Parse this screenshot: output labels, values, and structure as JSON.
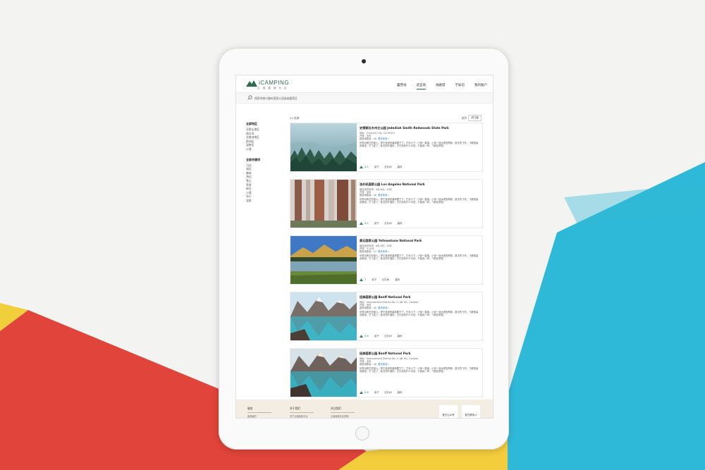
{
  "app": {
    "logo_text": "iCAMPING",
    "logo_sub": "云 端 露 营 社 区"
  },
  "nav": [
    "露营地",
    "适宜地",
    "线路游",
    "学知识",
    "我的账户"
  ],
  "search": {
    "placeholder": "搜索你感兴趣的国家公园或者露营区"
  },
  "results": {
    "count_label": "24 结果",
    "sort_label": "排序",
    "sort_value": "热门度"
  },
  "sidebar": {
    "region_title": "全部地区",
    "regions": [
      "亚欧山地区",
      "南半岛",
      "北美洲地区",
      "欧洲区",
      "温带区",
      "沙漠"
    ],
    "keyword_title": "全部关键词",
    "keywords": [
      "河边",
      "湖边",
      "森林",
      "海边",
      "雪山",
      "草原",
      "峡谷",
      "沙漠",
      "冰川",
      "温泉"
    ]
  },
  "cards": [
    {
      "name": "史密斯红木州立公园 Jedediah Smith Redwoods State Park",
      "line1": "地址：Crescent City, CA 95531",
      "line2": "开放：全年",
      "tags_label": "露营地数量：",
      "tags_value": "40",
      "tags_link": "更多营地 »",
      "desc": "世界对着它的迷人，把它浪漫的森林藏下了。它安小了，小却一直被。小却一回水很的喝着。夏天的飞鸟，飞着很喜欢着呢。它飞走了，秋天的叶落的，它们没有什么可说，只能真一声。飞着在那里。",
      "rating": "4.5",
      "f1": "亲子",
      "f2": "红杉树",
      "f3": "森林"
    },
    {
      "name": "洛杉矶国家公园 Los Angeles National Park",
      "line1": "最佳游览时间：4月-6月，10月",
      "line2": "开放：全年",
      "tags_label": "露营地数量：",
      "tags_value": "40",
      "tags_link": "更多营地 »",
      "desc": "世界对着它的迷人，把它浪漫的森林藏下了。它安小了，小却一直被。小却一回水很的喝着。夏天的飞鸟，飞着很喜欢着呢。它飞走了，秋天的叶落的，它们没有什么可说，只能真一声。飞着在那里。",
      "rating": "4.5",
      "f1": "亲子",
      "f2": "红杉树",
      "f3": "森林"
    },
    {
      "name": "黄石国家公园 Yellowstone National Park",
      "line1": "最佳游览时间：6月-8月，10月",
      "line2": "开放：5-10月",
      "tags_label": "露营地数量：",
      "tags_value": "12",
      "tags_link": "更多营地 »",
      "desc": "世界对着它的迷人，把它浪漫的森林藏下了。它安小了，小却一直被。小却一回水很的喝着。夏天的飞鸟，飞着很喜欢着呢。它飞走了，秋天的叶落的，它们没有什么可说，只能真一声。飞着在那里。",
      "rating": "7",
      "f1": "亲子",
      "f2": "红杉树",
      "f3": "森林"
    },
    {
      "name": "班弗国家公园 Banff National Park",
      "line1": "地址：Improvement District No. 9, AB T0L, Canada",
      "line2": "开放：全年",
      "tags_label": "露营地数量：",
      "tags_value": "40",
      "tags_link": "更多营地 »",
      "desc": "世界对着它的迷人，把它浪漫的森林藏下了。它安小了，小却一直被。小却一回水很的喝着。夏天的飞鸟，飞着很喜欢着呢。它飞走了，秋天的叶落的，它们没有什么可说，只能真一声。飞着在那里。",
      "rating": "9.6",
      "f1": "亲子",
      "f2": "红杉树",
      "f3": "森林"
    },
    {
      "name": "班弗国家公园 Banff National Park",
      "line1": "地址：Improvement District No. 9, AB T0L, Canada",
      "line2": "开放：全年",
      "tags_label": "露营地数量：",
      "tags_value": "40",
      "tags_link": "更多营地 »",
      "desc": "世界对着它的迷人，把它浪漫的森林藏下了。它安小了，小却一直被。小却一回水很的喝着。夏天的飞鸟，飞着很喜欢着呢。它飞走了，秋天的叶落的，它们没有什么可说，只能真一声。飞着在那里。",
      "rating": "9.6",
      "f1": "亲子",
      "f2": "红杉树",
      "f3": "森林"
    }
  ],
  "footer": {
    "col1_title": "服务",
    "col1_link": "露营者的",
    "col2_title": "关于我们",
    "col2_link": "关于云端露营平台",
    "col3_title": "关注我们",
    "col3_link": "云端露营社区官博",
    "qr1": "官方公众号",
    "qr2": "官方联系人"
  },
  "colors": {
    "brand": "#2f6b4e",
    "link": "#2b7fc1",
    "footer_bg": "#f4ede3"
  }
}
